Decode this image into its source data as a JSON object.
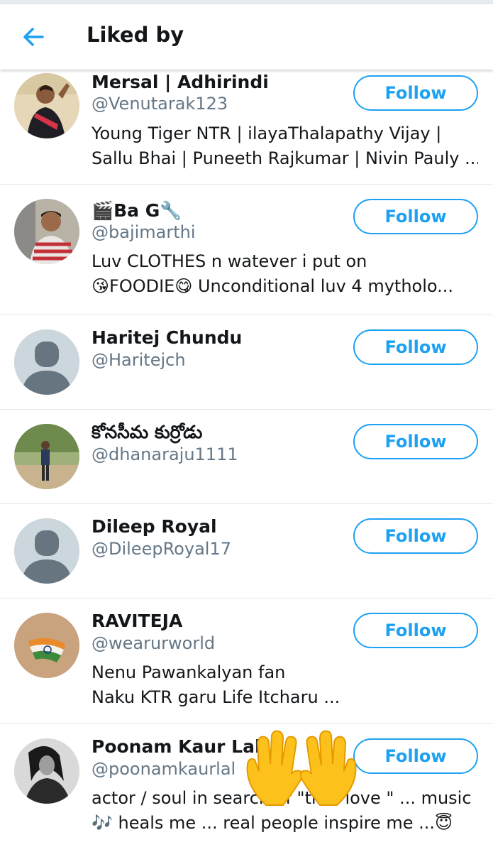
{
  "header": {
    "title": "Liked by",
    "back_icon": "arrow-left-icon"
  },
  "follow_label": "Follow",
  "accent_color": "#1da1f2",
  "users": [
    {
      "name": "Mersal | Adhirindi",
      "handle": "@Venutarak123",
      "bio_lines": [
        "Young Tiger NTR | ilayaThalapathy Vijay |",
        "Sallu Bhai | Puneeth Rajkumar | Nivin Pauly ..."
      ]
    },
    {
      "name": "🎬Ba G🔧",
      "handle": "@bajimarthi",
      "bio_lines": [
        "Luv CLOTHES n watever i put on",
        "😘FOODIE😋 Unconditional luv 4 mytholo..."
      ]
    },
    {
      "name": "Haritej Chundu",
      "handle": "@Haritejch",
      "bio_lines": []
    },
    {
      "name": "కోనసీమ కుర్రోడు",
      "handle": "@dhanaraju1111",
      "bio_lines": []
    },
    {
      "name": "Dileep Royal",
      "handle": "@DileepRoyal17",
      "bio_lines": []
    },
    {
      "name": "RAVITEJA",
      "handle": "@wearurworld",
      "bio_lines": [
        "Nenu Pawankalyan fan",
        "Naku KTR garu Life Itcharu ..."
      ]
    },
    {
      "name": "Poonam Kaur Lal",
      "handle": "@poonamkaurlal",
      "bio_lines": [
        "actor / soul in search of \"true love \" ... music",
        "🎶 heals me ... real people inspire me ...😇"
      ]
    }
  ]
}
